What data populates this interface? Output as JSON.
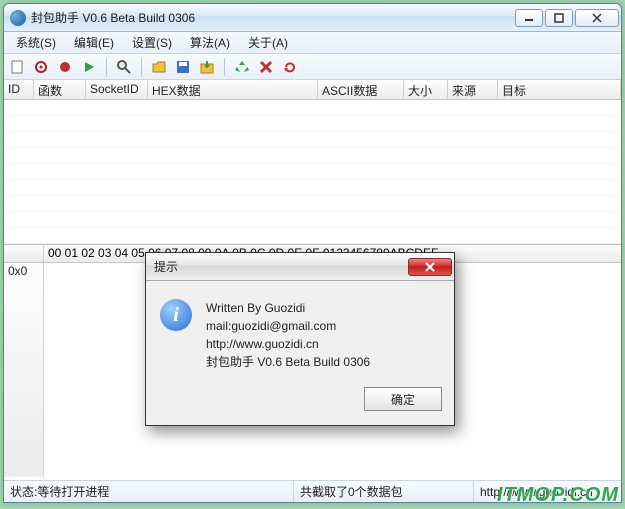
{
  "window": {
    "title": "封包助手 V0.6 Beta Build 0306"
  },
  "menu": {
    "system": "系统(S)",
    "edit": "编辑(E)",
    "settings": "设置(S)",
    "algorithm": "算法(A)",
    "about": "关于(A)"
  },
  "columns": {
    "id": "ID",
    "func": "函数",
    "socket": "SocketID",
    "hex": "HEX数据",
    "ascii": "ASCII数据",
    "size": "大小",
    "source": "来源",
    "target": "目标"
  },
  "hex": {
    "header": "00 01 02 03 04 05 06 07 08 09 0A 0B 0C 0D 0E 0F  0123456789ABCDEF",
    "addr0": "0x0"
  },
  "status": {
    "left": "状态:等待打开进程",
    "mid": "共截取了0个数据包",
    "url": "http://www.guozidi.cn"
  },
  "dialog": {
    "title": "提示",
    "line1": "Written By Guozidi",
    "line2": "mail:guozidi@gmail.com",
    "line3": "http://www.guozidi.cn",
    "line4": "封包助手 V0.6 Beta Build 0306",
    "ok": "确定"
  },
  "watermark": "ITMOP.COM"
}
